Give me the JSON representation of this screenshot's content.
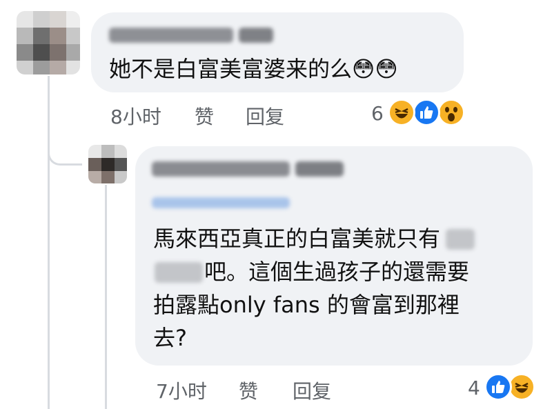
{
  "comment1": {
    "text": "她不是白富美富婆来的么😳😳",
    "time": "8小时",
    "like_label": "赞",
    "reply_label": "回复",
    "reaction_count": "6",
    "reactions": [
      "haha-icon",
      "like-icon",
      "wow-icon"
    ]
  },
  "comment2": {
    "lines": [
      "馬來西亞真正的白富美就只有",
      "吧。這個生過孩子的還需要",
      "拍露點only fans 的會富到那裡",
      "去?"
    ],
    "time": "7小时",
    "like_label": "赞",
    "reply_label": "回复",
    "reaction_count": "4",
    "reactions": [
      "like-icon",
      "haha-icon"
    ]
  },
  "colors": {
    "bubble": "#f0f2f5",
    "meta_text": "#5f6368",
    "like_blue": "#1877f2",
    "reaction_yellow": "#f7b125"
  }
}
